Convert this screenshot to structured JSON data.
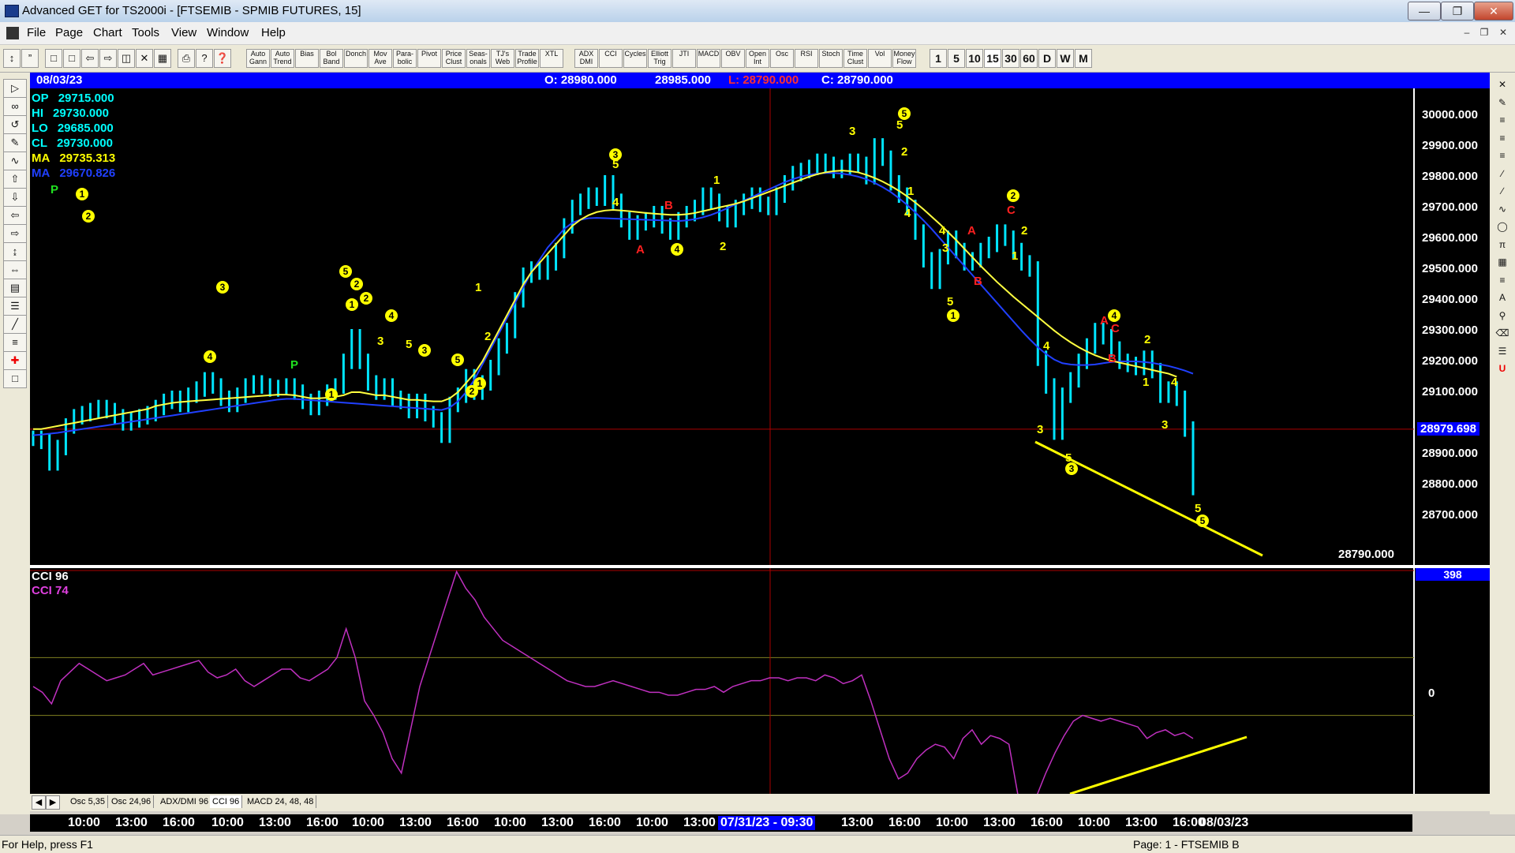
{
  "window": {
    "title": "Advanced GET for TS2000i - [FTSEMIB - SPMIB FUTURES, 15]",
    "controls": [
      "minimize",
      "restore",
      "close"
    ]
  },
  "menu": [
    "File",
    "Page",
    "Chart",
    "Tools",
    "View",
    "Window",
    "Help"
  ],
  "toolbar": {
    "study_buttons": [
      "Auto Gann",
      "Auto Trend",
      "Bias",
      "Bol Band",
      "Donch",
      "Mov Ave",
      "Para-bolic",
      "Pivot",
      "Price Clust",
      "Seas-onals",
      "TJ's Web",
      "Trade Profile",
      "XTL",
      "ADX DMI",
      "CCI",
      "Cycles",
      "Elliott Trig",
      "JTI",
      "MACD",
      "OBV",
      "Open Int",
      "Osc",
      "RSI",
      "Stoch",
      "Time Clust",
      "Vol",
      "Money Flow"
    ],
    "timeframes": [
      "1",
      "5",
      "10",
      "15",
      "30",
      "60",
      "D",
      "W",
      "M"
    ]
  },
  "infobar": {
    "date": "08/03/23",
    "open": "O: 28980.000",
    "high": "28985.000",
    "low": "L: 28790.000",
    "close": "C: 28790.000"
  },
  "stats": [
    {
      "label": "OP",
      "value": "29715.000",
      "color": "#00ffff"
    },
    {
      "label": "HI",
      "value": "29730.000",
      "color": "#00ffff"
    },
    {
      "label": "LO",
      "value": "29685.000",
      "color": "#00ffff"
    },
    {
      "label": "CL",
      "value": "29730.000",
      "color": "#00ffff"
    },
    {
      "label": "MA",
      "value": "29735.313",
      "color": "#ffff00"
    },
    {
      "label": "MA",
      "value": "29670.826",
      "color": "#2040ff"
    }
  ],
  "price_axis": {
    "ticks": [
      "30000.000",
      "29900.000",
      "29800.000",
      "29700.000",
      "29600.000",
      "29500.000",
      "29400.000",
      "29300.000",
      "29200.000",
      "29100.000",
      "28900.000",
      "28800.000",
      "28700.000"
    ],
    "current_label": "28979.698",
    "last_label": "28790.000"
  },
  "oscillator": {
    "legend1": "CCI 96",
    "legend2": "CCI  74",
    "top_label": "398",
    "zero_label": "0"
  },
  "osc_tabs": [
    "Osc 5,35",
    "Osc 24,96",
    "ADX/DMI 96",
    "CCI 96",
    "MACD 24, 48, 48"
  ],
  "active_tab": "CCI 96",
  "time_axis": {
    "labels": [
      "10:00",
      "13:00",
      "16:00",
      "10:00",
      "13:00",
      "16:00",
      "10:00",
      "13:00",
      "16:00",
      "10:00",
      "13:00",
      "16:00",
      "10:00",
      "13:00",
      "13:00",
      "16:00",
      "10:00",
      "13:00",
      "16:00",
      "10:00",
      "13:00",
      "16:00",
      "08/03/23"
    ],
    "cursor_label": "07/31/23 - 09:30"
  },
  "status": {
    "left": "For Help, press F1",
    "right": "Page: 1 - FTSEMIB B"
  },
  "chart_data": {
    "type": "line",
    "title": "",
    "y_range": [
      28600,
      30040
    ],
    "close": [
      28950,
      28940,
      28870,
      28920,
      28990,
      29020,
      29030,
      29040,
      29050,
      29040,
      29020,
      29000,
      29010,
      29020,
      29030,
      29050,
      29070,
      29080,
      29060,
      29090,
      29110,
      29140,
      29120,
      29080,
      29060,
      29090,
      29120,
      29130,
      29120,
      29110,
      29115,
      29120,
      29100,
      29070,
      29050,
      29080,
      29100,
      29120,
      29200,
      29280,
      29200,
      29130,
      29100,
      29120,
      29080,
      29070,
      29040,
      29070,
      29030,
      29010,
      28960,
      29060,
      29090,
      29150,
      29100,
      29130,
      29180,
      29250,
      29300,
      29400,
      29480,
      29500,
      29490,
      29520,
      29560,
      29640,
      29700,
      29720,
      29740,
      29730,
      29780,
      29720,
      29660,
      29620,
      29650,
      29660,
      29680,
      29640,
      29620,
      29660,
      29680,
      29700,
      29740,
      29720,
      29680,
      29660,
      29700,
      29720,
      29740,
      29710,
      29700,
      29740,
      29780,
      29810,
      29820,
      29830,
      29850,
      29840,
      29820,
      29830,
      29850,
      29840,
      29800,
      29900,
      29860,
      29780,
      29740,
      29700,
      29620,
      29530,
      29460,
      29540,
      29600,
      29560,
      29520,
      29530,
      29560,
      29580,
      29620,
      29600,
      29560,
      29520,
      29500,
      29210,
      29120,
      28970,
      29090,
      29140,
      29200,
      29250,
      29300,
      29280,
      29240,
      29200,
      29190,
      29180,
      29210,
      29170,
      29090,
      29110,
      29080,
      28980,
      28790
    ],
    "ma_yellow": [
      28980,
      28980,
      28985,
      28990,
      28995,
      29000,
      29005,
      29010,
      29015,
      29020,
      29025,
      29030,
      29035,
      29040,
      29045,
      29055,
      29060,
      29065,
      29068,
      29070,
      29072,
      29074,
      29076,
      29078,
      29080,
      29082,
      29084,
      29086,
      29088,
      29090,
      29092,
      29092,
      29090,
      29085,
      29080,
      29080,
      29082,
      29085,
      29090,
      29100,
      29100,
      29095,
      29090,
      29090,
      29085,
      29080,
      29075,
      29075,
      29072,
      29070,
      29070,
      29080,
      29100,
      29130,
      29160,
      29200,
      29250,
      29300,
      29350,
      29400,
      29450,
      29490,
      29520,
      29550,
      29580,
      29610,
      29640,
      29660,
      29675,
      29685,
      29690,
      29692,
      29690,
      29688,
      29685,
      29682,
      29680,
      29678,
      29676,
      29676,
      29678,
      29682,
      29688,
      29694,
      29700,
      29706,
      29712,
      29720,
      29730,
      29740,
      29750,
      29760,
      29770,
      29780,
      29790,
      29800,
      29808,
      29814,
      29818,
      29820,
      29818,
      29814,
      29806,
      29796,
      29784,
      29770,
      29754,
      29736,
      29716,
      29694,
      29670,
      29646,
      29620,
      29594,
      29566,
      29538,
      29510,
      29484,
      29458,
      29434,
      29410,
      29388,
      29366,
      29344,
      29322,
      29300,
      29280,
      29262,
      29246,
      29232,
      29220,
      29210,
      29202,
      29196,
      29190,
      29184,
      29178,
      29172,
      29166,
      29160,
      29150
    ],
    "ma_blue": [
      28960,
      28962,
      28965,
      28968,
      28972,
      28976,
      28980,
      28984,
      28988,
      28992,
      28996,
      29000,
      29004,
      29008,
      29012,
      29016,
      29020,
      29024,
      29028,
      29032,
      29036,
      29040,
      29044,
      29048,
      29052,
      29056,
      29060,
      29064,
      29068,
      29072,
      29076,
      29078,
      29078,
      29076,
      29074,
      29072,
      29070,
      29068,
      29066,
      29064,
      29062,
      29060,
      29058,
      29056,
      29054,
      29052,
      29050,
      29048,
      29046,
      29044,
      29042,
      29050,
      29070,
      29100,
      29140,
      29190,
      29240,
      29290,
      29340,
      29390,
      29440,
      29490,
      29530,
      29570,
      29600,
      29630,
      29650,
      29660,
      29665,
      29666,
      29665,
      29664,
      29663,
      29662,
      29661,
      29660,
      29659,
      29658,
      29657,
      29656,
      29658,
      29662,
      29668,
      29676,
      29686,
      29698,
      29710,
      29722,
      29734,
      29746,
      29758,
      29770,
      29782,
      29792,
      29800,
      29806,
      29810,
      29812,
      29812,
      29810,
      29806,
      29800,
      29792,
      29780,
      29766,
      29750,
      29730,
      29708,
      29684,
      29658,
      29630,
      29600,
      29570,
      29540,
      29510,
      29480,
      29450,
      29420,
      29390,
      29360,
      29330,
      29300,
      29272,
      29246,
      29224,
      29206,
      29194,
      29190,
      29188,
      29188,
      29190,
      29194,
      29198,
      29200,
      29200,
      29200,
      29198,
      29195,
      29190,
      29185,
      29178,
      29170,
      29160
    ],
    "cci": [
      0,
      -20,
      -60,
      20,
      50,
      80,
      60,
      40,
      20,
      30,
      40,
      60,
      80,
      40,
      50,
      60,
      70,
      80,
      90,
      50,
      30,
      40,
      60,
      20,
      0,
      20,
      40,
      60,
      60,
      30,
      20,
      40,
      60,
      100,
      200,
      100,
      -50,
      -100,
      -160,
      -250,
      -300,
      -150,
      0,
      100,
      200,
      300,
      398,
      340,
      300,
      240,
      200,
      160,
      140,
      120,
      100,
      80,
      60,
      40,
      20,
      10,
      0,
      0,
      10,
      20,
      10,
      0,
      -10,
      -20,
      -20,
      -30,
      -30,
      -20,
      -10,
      -10,
      0,
      -20,
      0,
      10,
      20,
      20,
      30,
      30,
      20,
      30,
      30,
      20,
      40,
      30,
      10,
      20,
      40,
      -50,
      -150,
      -250,
      -320,
      -300,
      -250,
      -220,
      -200,
      -210,
      -250,
      -180,
      -150,
      -200,
      -170,
      -180,
      -200,
      -380,
      -420,
      -380,
      -300,
      -230,
      -170,
      -120,
      -100,
      -110,
      -120,
      -110,
      -120,
      -130,
      -140,
      -180,
      -160,
      -150,
      -170,
      -160,
      -180
    ]
  }
}
